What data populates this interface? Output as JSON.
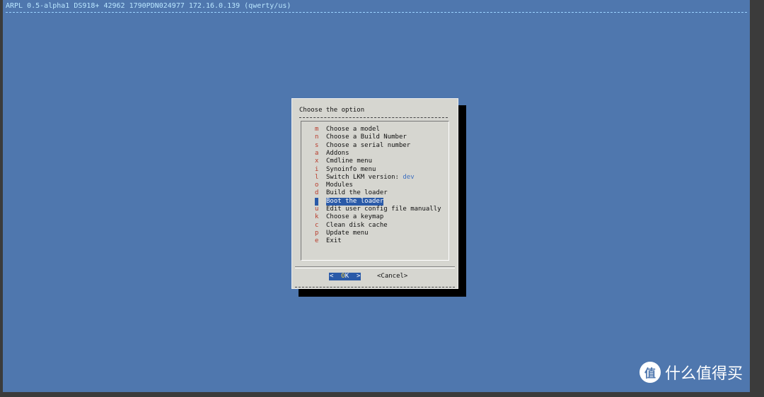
{
  "header": {
    "status_line": "ARPL 0.5-alpha1 DS918+ 42962 1790PDN024977 172.16.0.139 (qwerty/us)"
  },
  "dialog": {
    "prompt": "Choose the option",
    "items": [
      {
        "key": "m",
        "label": "Choose a model",
        "suffix": ""
      },
      {
        "key": "n",
        "label": "Choose a Build Number",
        "suffix": ""
      },
      {
        "key": "s",
        "label": "Choose a serial number",
        "suffix": ""
      },
      {
        "key": "a",
        "label": "Addons",
        "suffix": ""
      },
      {
        "key": "x",
        "label": "Cmdline menu",
        "suffix": ""
      },
      {
        "key": "i",
        "label": "Synoinfo menu",
        "suffix": ""
      },
      {
        "key": "l",
        "label": "Switch LKM version: ",
        "suffix": "dev"
      },
      {
        "key": "o",
        "label": "Modules",
        "suffix": ""
      },
      {
        "key": "d",
        "label": "Build the loader",
        "suffix": ""
      },
      {
        "key": "b",
        "label": "Boot the loader",
        "suffix": "",
        "selected": true
      },
      {
        "key": "u",
        "label": "Edit user config file manually",
        "suffix": ""
      },
      {
        "key": "k",
        "label": "Choose a keymap",
        "suffix": ""
      },
      {
        "key": "c",
        "label": "Clean disk cache",
        "suffix": ""
      },
      {
        "key": "p",
        "label": "Update menu",
        "suffix": ""
      },
      {
        "key": "e",
        "label": "Exit",
        "suffix": ""
      }
    ],
    "buttons": {
      "ok_left": "<  ",
      "ok_hot": "O",
      "ok_rest": "K  >",
      "cancel": "<Cancel>"
    }
  },
  "watermark": {
    "icon_glyph": "值",
    "text": "什么值得买"
  },
  "colors": {
    "screen_bg": "#4f77ae",
    "dialog_bg": "#d6d6d0",
    "selection": "#2a5aa8",
    "hotkey": "#b83c2c"
  }
}
